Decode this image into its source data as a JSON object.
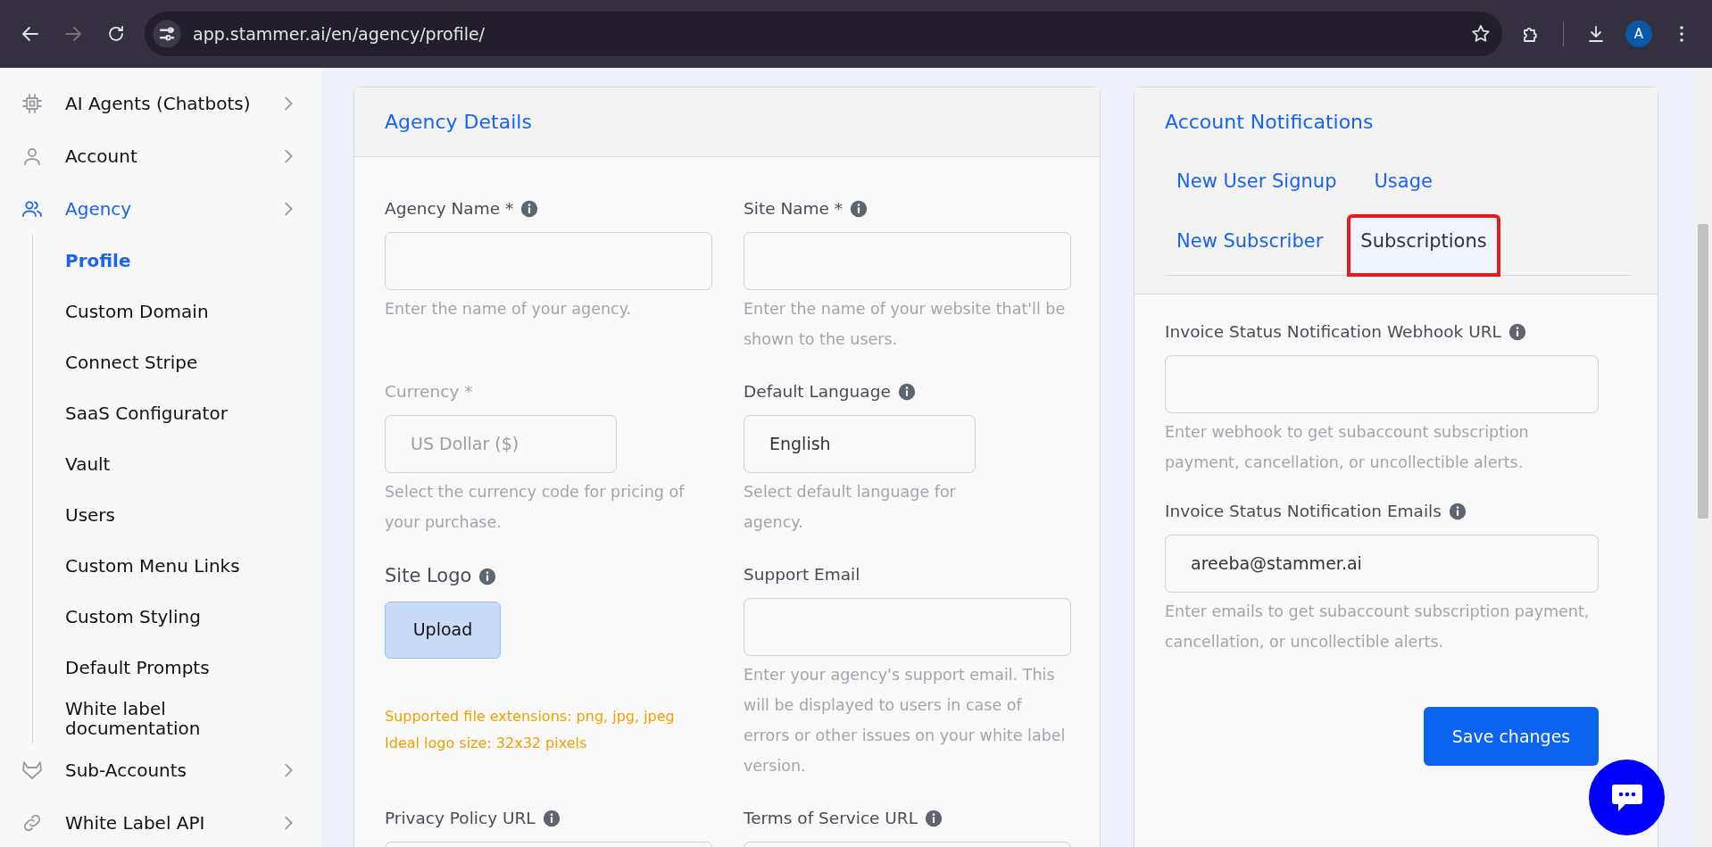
{
  "browser": {
    "url": "app.stammer.ai/en/agency/profile/",
    "back_disabled": false,
    "forward_disabled": true,
    "avatar_initial": "A"
  },
  "sidebar": {
    "items": [
      {
        "label": "AI Agents (Chatbots)",
        "selected": false
      },
      {
        "label": "Account",
        "selected": false
      },
      {
        "label": "Agency",
        "selected": true,
        "children": [
          {
            "label": "Profile",
            "selected": true
          },
          {
            "label": "Custom Domain",
            "selected": false
          },
          {
            "label": "Connect Stripe",
            "selected": false
          },
          {
            "label": "SaaS Configurator",
            "selected": false
          },
          {
            "label": "Vault",
            "selected": false
          },
          {
            "label": "Users",
            "selected": false
          },
          {
            "label": "Custom Menu Links",
            "selected": false
          },
          {
            "label": "Custom Styling",
            "selected": false
          },
          {
            "label": "Default Prompts",
            "selected": false
          },
          {
            "label": "White label documentation",
            "selected": false
          }
        ]
      },
      {
        "label": "Sub-Accounts",
        "selected": false
      },
      {
        "label": "White Label API",
        "selected": false
      }
    ]
  },
  "agency_details": {
    "title": "Agency Details",
    "fields": [
      {
        "kind": "input",
        "label": "Agency Name *",
        "info": true,
        "disabled": false,
        "help": "Enter the name of your agency."
      },
      {
        "kind": "input",
        "label": "Site Name *",
        "info": true,
        "disabled": false,
        "help": "Enter the name of your website that'll be shown to the users."
      },
      {
        "kind": "select",
        "label": "Currency *",
        "info": false,
        "disabled": true,
        "value": "US Dollar ($)",
        "help": "Select the currency code for pricing of your purchase."
      },
      {
        "kind": "select",
        "label": "Default Language",
        "info": true,
        "disabled": false,
        "value": "English",
        "help": "Select default language for agency."
      },
      {
        "kind": "upload",
        "label": "Site Logo",
        "info": true,
        "button": "Upload",
        "notes": [
          "Supported file extensions: png, jpg, jpeg",
          "Ideal logo size: 32x32 pixels"
        ]
      },
      {
        "kind": "input",
        "label": "Support Email",
        "info": false,
        "disabled": false,
        "help": "Enter your agency's support email. This will be displayed to users in case of errors or other issues on your white label version."
      },
      {
        "kind": "input",
        "label": "Privacy Policy URL",
        "info": true,
        "disabled": false
      },
      {
        "kind": "input",
        "label": "Terms of Service URL",
        "info": true,
        "disabled": false
      }
    ]
  },
  "account_notifications": {
    "title": "Account Notifications",
    "tabs": [
      {
        "label": "New User Signup",
        "selected": false,
        "highlighted": false
      },
      {
        "label": "Usage",
        "selected": false,
        "highlighted": false
      },
      {
        "label": "New Subscriber",
        "selected": false,
        "highlighted": false
      },
      {
        "label": "Subscriptions",
        "selected": true,
        "highlighted": true
      }
    ],
    "fields": [
      {
        "label": "Invoice Status Notification Webhook URL",
        "info": true,
        "help": "Enter webhook to get subaccount subscription payment, cancellation, or uncollectible alerts."
      },
      {
        "label": "Invoice Status Notification Emails",
        "info": true,
        "value": "areeba@stammer.ai",
        "help": "Enter emails to get subaccount subscription payment, cancellation, or uncollectible alerts."
      }
    ],
    "save_button": "Save changes"
  }
}
